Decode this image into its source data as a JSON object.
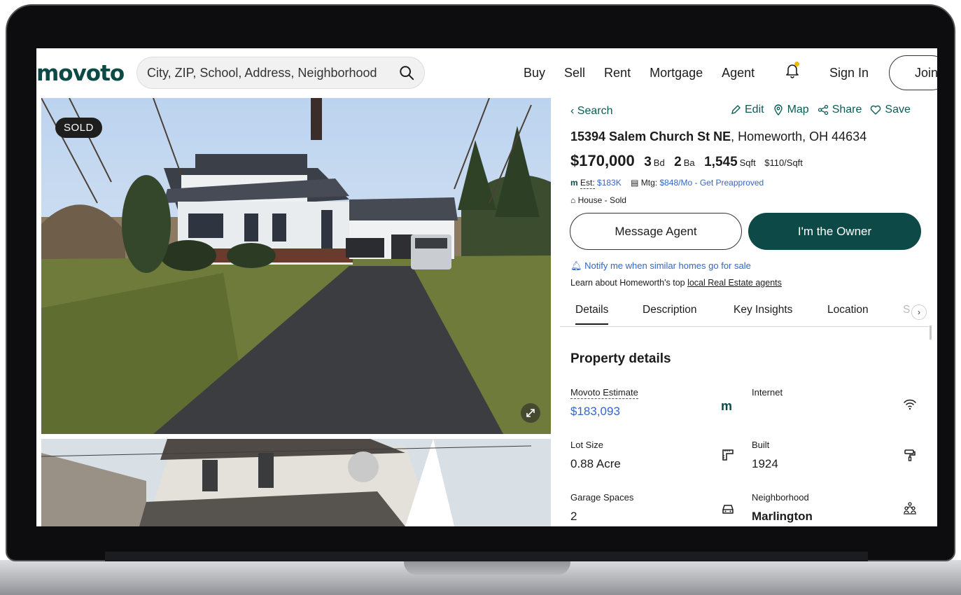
{
  "header": {
    "logo": "movoto",
    "search_placeholder": "City, ZIP, School, Address, Neighborhood",
    "nav": [
      "Buy",
      "Sell",
      "Rent",
      "Mortgage",
      "Agent"
    ],
    "sign_in": "Sign In",
    "join": "Join"
  },
  "photo": {
    "badge": "SOLD"
  },
  "listing": {
    "back": "Search",
    "actions": [
      "Edit",
      "Map",
      "Share",
      "Save"
    ],
    "street": "15394 Salem Church St NE",
    "city": ", Homeworth, OH 44634",
    "price": "$170,000",
    "beds": "3",
    "beds_unit": "Bd",
    "baths": "2",
    "baths_unit": "Ba",
    "sqft": "1,545",
    "sqft_unit": "Sqft",
    "price_per_sqft": "$110/Sqft",
    "est_label": "Est:",
    "est_value": "$183K",
    "mtg_label": "Mtg:",
    "mtg_value": "$848/Mo",
    "preapproved": " - Get Preapproved",
    "status": "House - Sold",
    "message_agent": "Message Agent",
    "owner": "I'm the Owner",
    "notify": "Notify me when similar homes go for sale",
    "learn_prefix": "Learn about Homeworth's top ",
    "learn_link": "local Real Estate agents"
  },
  "tabs": [
    "Details",
    "Description",
    "Key Insights",
    "Location",
    "S"
  ],
  "details": {
    "title": "Property details",
    "movoto_estimate_label": "Movoto Estimate",
    "movoto_estimate_value": "$183,093",
    "internet_label": "Internet",
    "lot_label": "Lot Size",
    "lot_value": "0.88 Acre",
    "built_label": "Built",
    "built_value": "1924",
    "garage_label": "Garage Spaces",
    "garage_value": "2",
    "neighborhood_label": "Neighborhood",
    "neighborhood_value": "Marlington"
  },
  "colors": {
    "brand": "#0b4a45",
    "link": "#3267c8",
    "owner_button": "#0d4a47"
  }
}
